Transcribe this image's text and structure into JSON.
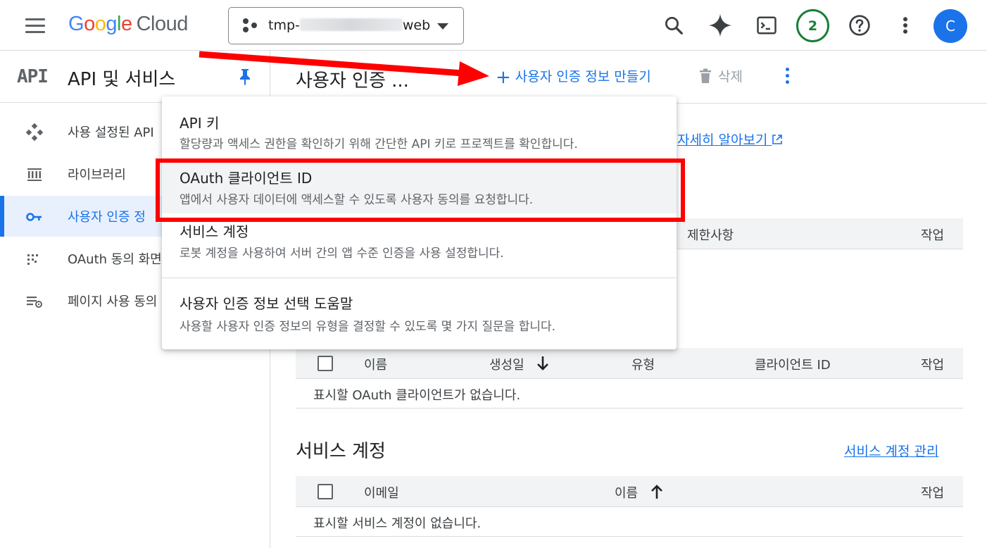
{
  "topbar": {
    "logo_google": [
      "G",
      "o",
      "o",
      "g",
      "l",
      "e"
    ],
    "logo_cloud": "Cloud",
    "project_prefix": "tmp-",
    "project_suffix": "web",
    "notifications_count": "2",
    "avatar_letter": "C"
  },
  "sidebar": {
    "api_badge": "API",
    "title": "API 및 서비스",
    "items": [
      {
        "label": "사용 설정된 API",
        "icon": "diamond-grid-icon"
      },
      {
        "label": "라이브러리",
        "icon": "library-icon"
      },
      {
        "label": "사용자 인증 정",
        "icon": "key-icon",
        "active": true
      },
      {
        "label": "OAuth 동의 화면",
        "icon": "consent-icon"
      },
      {
        "label": "페이지 사용 동의",
        "icon": "settings-list-icon"
      }
    ]
  },
  "main": {
    "page_title": "사용자 인증 ...",
    "create_label": "사용자 인증 정보 만들기",
    "delete_label": "삭제",
    "learn_more": "자세히 알아보기",
    "api_keys_table": {
      "col_restrictions": "제한사항",
      "col_actions": "작업"
    },
    "oauth_table": {
      "col_name": "이름",
      "col_created": "생성일",
      "col_type": "유형",
      "col_client_id": "클라이언트 ID",
      "col_actions": "작업",
      "empty": "표시할 OAuth 클라이언트가 없습니다."
    },
    "service_accounts": {
      "title": "서비스 계정",
      "manage_link": "서비스 계정 관리",
      "col_email": "이메일",
      "col_name": "이름",
      "col_actions": "작업",
      "empty": "표시할 서비스 계정이 없습니다."
    }
  },
  "menu": {
    "items": [
      {
        "title": "API 키",
        "desc": "할당량과 액세스 권한을 확인하기 위해 간단한 API 키로 프로젝트를 확인합니다."
      },
      {
        "title": "OAuth 클라이언트 ID",
        "desc": "앱에서 사용자 데이터에 액세스할 수 있도록 사용자 동의를 요청합니다."
      },
      {
        "title": "서비스 계정",
        "desc": "로봇 계정을 사용하여 서버 간의 앱 수준 인증을 사용 설정합니다."
      },
      {
        "title": "사용자 인증 정보 선택 도움말",
        "desc": "사용할 사용자 인증 정보의 유형을 결정할 수 있도록 몇 가지 질문을 합니다."
      }
    ]
  },
  "colors": {
    "accent": "#1a73e8",
    "annotation": "#ff0000"
  }
}
